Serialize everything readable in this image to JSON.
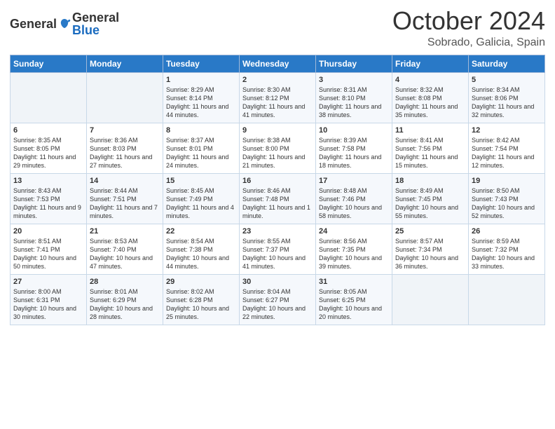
{
  "header": {
    "logo_general": "General",
    "logo_blue": "Blue",
    "month": "October 2024",
    "location": "Sobrado, Galicia, Spain"
  },
  "days_of_week": [
    "Sunday",
    "Monday",
    "Tuesday",
    "Wednesday",
    "Thursday",
    "Friday",
    "Saturday"
  ],
  "weeks": [
    [
      {
        "day": "",
        "info": ""
      },
      {
        "day": "",
        "info": ""
      },
      {
        "day": "1",
        "info": "Sunrise: 8:29 AM\nSunset: 8:14 PM\nDaylight: 11 hours and 44 minutes."
      },
      {
        "day": "2",
        "info": "Sunrise: 8:30 AM\nSunset: 8:12 PM\nDaylight: 11 hours and 41 minutes."
      },
      {
        "day": "3",
        "info": "Sunrise: 8:31 AM\nSunset: 8:10 PM\nDaylight: 11 hours and 38 minutes."
      },
      {
        "day": "4",
        "info": "Sunrise: 8:32 AM\nSunset: 8:08 PM\nDaylight: 11 hours and 35 minutes."
      },
      {
        "day": "5",
        "info": "Sunrise: 8:34 AM\nSunset: 8:06 PM\nDaylight: 11 hours and 32 minutes."
      }
    ],
    [
      {
        "day": "6",
        "info": "Sunrise: 8:35 AM\nSunset: 8:05 PM\nDaylight: 11 hours and 29 minutes."
      },
      {
        "day": "7",
        "info": "Sunrise: 8:36 AM\nSunset: 8:03 PM\nDaylight: 11 hours and 27 minutes."
      },
      {
        "day": "8",
        "info": "Sunrise: 8:37 AM\nSunset: 8:01 PM\nDaylight: 11 hours and 24 minutes."
      },
      {
        "day": "9",
        "info": "Sunrise: 8:38 AM\nSunset: 8:00 PM\nDaylight: 11 hours and 21 minutes."
      },
      {
        "day": "10",
        "info": "Sunrise: 8:39 AM\nSunset: 7:58 PM\nDaylight: 11 hours and 18 minutes."
      },
      {
        "day": "11",
        "info": "Sunrise: 8:41 AM\nSunset: 7:56 PM\nDaylight: 11 hours and 15 minutes."
      },
      {
        "day": "12",
        "info": "Sunrise: 8:42 AM\nSunset: 7:54 PM\nDaylight: 11 hours and 12 minutes."
      }
    ],
    [
      {
        "day": "13",
        "info": "Sunrise: 8:43 AM\nSunset: 7:53 PM\nDaylight: 11 hours and 9 minutes."
      },
      {
        "day": "14",
        "info": "Sunrise: 8:44 AM\nSunset: 7:51 PM\nDaylight: 11 hours and 7 minutes."
      },
      {
        "day": "15",
        "info": "Sunrise: 8:45 AM\nSunset: 7:49 PM\nDaylight: 11 hours and 4 minutes."
      },
      {
        "day": "16",
        "info": "Sunrise: 8:46 AM\nSunset: 7:48 PM\nDaylight: 11 hours and 1 minute."
      },
      {
        "day": "17",
        "info": "Sunrise: 8:48 AM\nSunset: 7:46 PM\nDaylight: 10 hours and 58 minutes."
      },
      {
        "day": "18",
        "info": "Sunrise: 8:49 AM\nSunset: 7:45 PM\nDaylight: 10 hours and 55 minutes."
      },
      {
        "day": "19",
        "info": "Sunrise: 8:50 AM\nSunset: 7:43 PM\nDaylight: 10 hours and 52 minutes."
      }
    ],
    [
      {
        "day": "20",
        "info": "Sunrise: 8:51 AM\nSunset: 7:41 PM\nDaylight: 10 hours and 50 minutes."
      },
      {
        "day": "21",
        "info": "Sunrise: 8:53 AM\nSunset: 7:40 PM\nDaylight: 10 hours and 47 minutes."
      },
      {
        "day": "22",
        "info": "Sunrise: 8:54 AM\nSunset: 7:38 PM\nDaylight: 10 hours and 44 minutes."
      },
      {
        "day": "23",
        "info": "Sunrise: 8:55 AM\nSunset: 7:37 PM\nDaylight: 10 hours and 41 minutes."
      },
      {
        "day": "24",
        "info": "Sunrise: 8:56 AM\nSunset: 7:35 PM\nDaylight: 10 hours and 39 minutes."
      },
      {
        "day": "25",
        "info": "Sunrise: 8:57 AM\nSunset: 7:34 PM\nDaylight: 10 hours and 36 minutes."
      },
      {
        "day": "26",
        "info": "Sunrise: 8:59 AM\nSunset: 7:32 PM\nDaylight: 10 hours and 33 minutes."
      }
    ],
    [
      {
        "day": "27",
        "info": "Sunrise: 8:00 AM\nSunset: 6:31 PM\nDaylight: 10 hours and 30 minutes."
      },
      {
        "day": "28",
        "info": "Sunrise: 8:01 AM\nSunset: 6:29 PM\nDaylight: 10 hours and 28 minutes."
      },
      {
        "day": "29",
        "info": "Sunrise: 8:02 AM\nSunset: 6:28 PM\nDaylight: 10 hours and 25 minutes."
      },
      {
        "day": "30",
        "info": "Sunrise: 8:04 AM\nSunset: 6:27 PM\nDaylight: 10 hours and 22 minutes."
      },
      {
        "day": "31",
        "info": "Sunrise: 8:05 AM\nSunset: 6:25 PM\nDaylight: 10 hours and 20 minutes."
      },
      {
        "day": "",
        "info": ""
      },
      {
        "day": "",
        "info": ""
      }
    ]
  ]
}
